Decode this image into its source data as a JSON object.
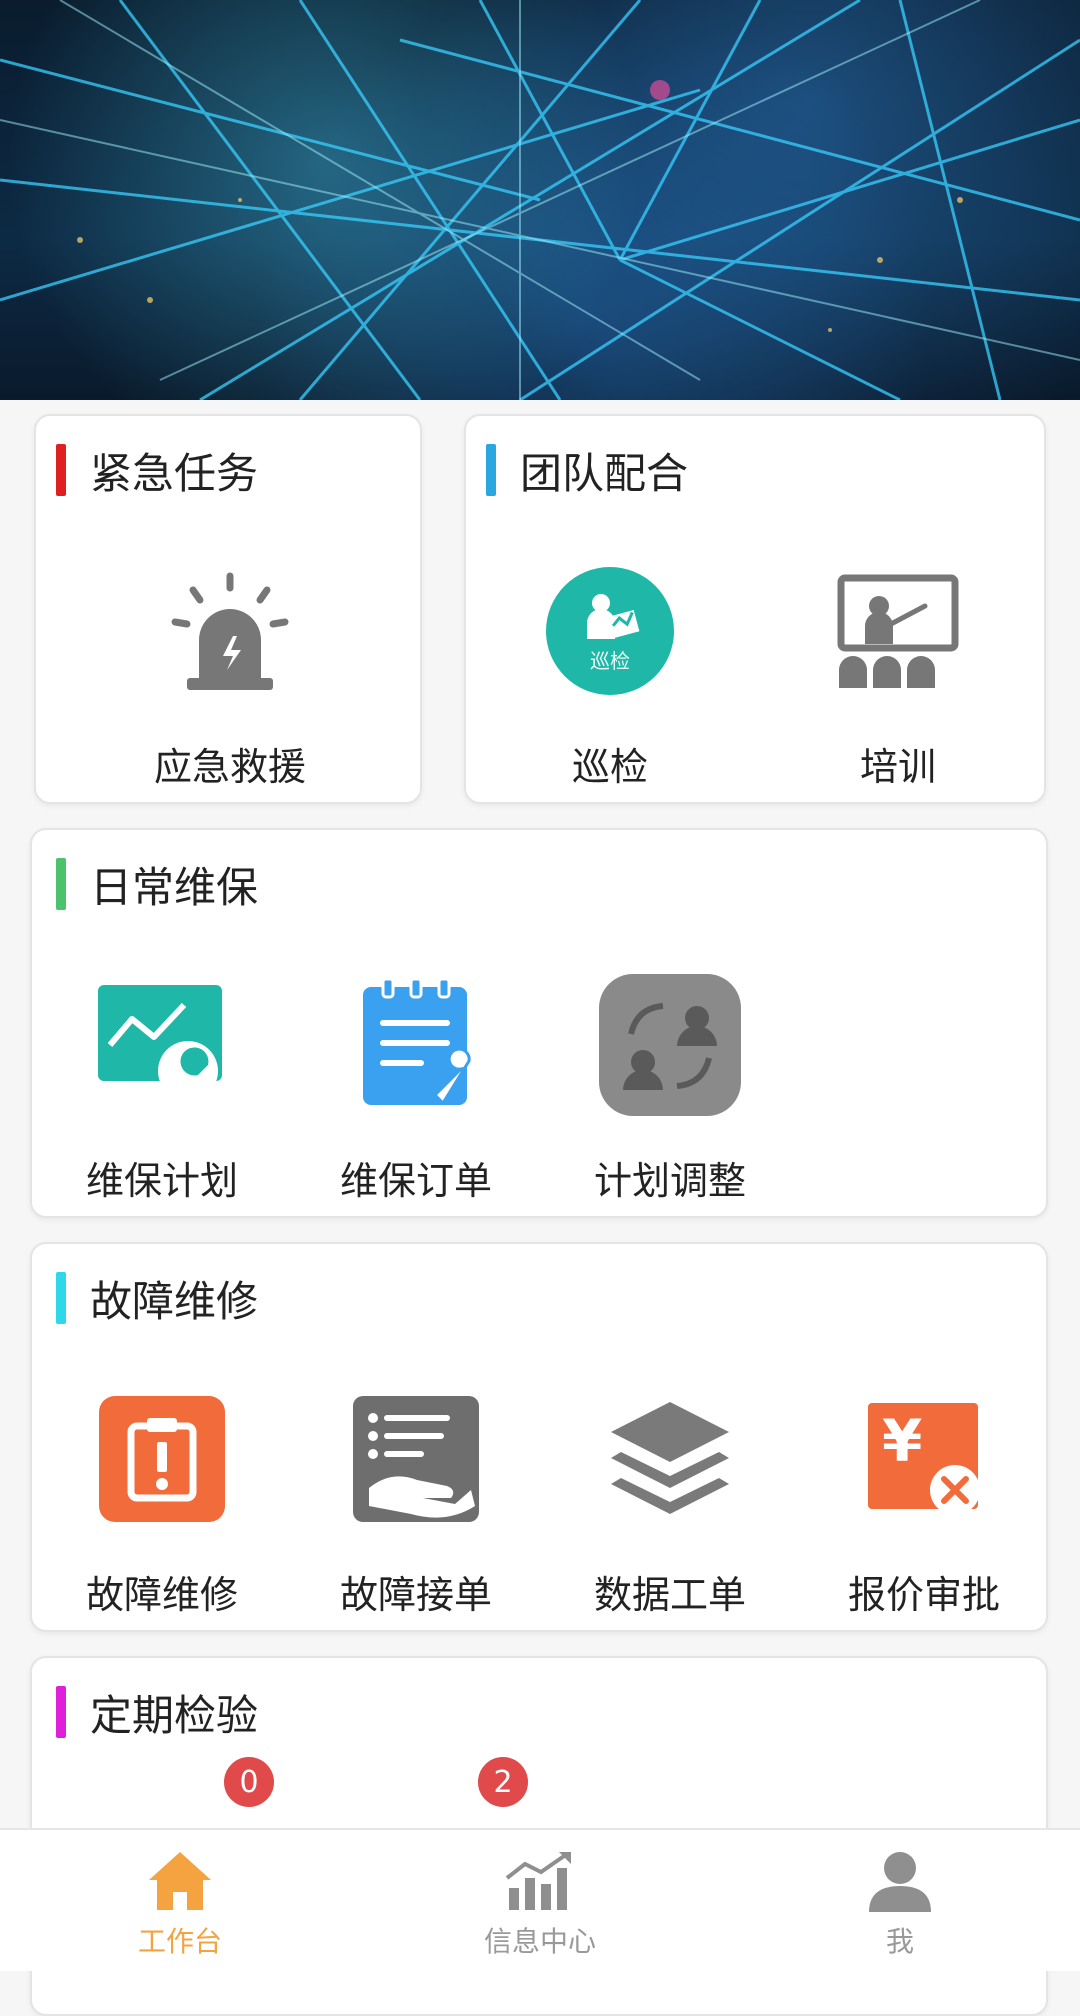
{
  "sections": {
    "emergency": {
      "title": "紧急任务",
      "accent": "#e02020",
      "items": [
        {
          "label": "应急救援",
          "icon": "alarm-light-icon"
        }
      ]
    },
    "team": {
      "title": "团队配合",
      "accent": "#2aa6e0",
      "items": [
        {
          "label": "巡检",
          "icon": "inspection-icon",
          "icon_text": "巡检"
        },
        {
          "label": "培训",
          "icon": "training-icon"
        }
      ]
    },
    "maintenance": {
      "title": "日常维保",
      "accent": "#4cc26a",
      "items": [
        {
          "label": "维保计划",
          "icon": "maintenance-plan-icon"
        },
        {
          "label": "维保订单",
          "icon": "maintenance-order-icon"
        },
        {
          "label": "计划调整",
          "icon": "plan-adjust-icon"
        }
      ]
    },
    "repair": {
      "title": "故障维修",
      "accent": "#2fd8e8",
      "items": [
        {
          "label": "故障维修",
          "icon": "fault-repair-icon"
        },
        {
          "label": "故障接单",
          "icon": "fault-accept-icon"
        },
        {
          "label": "数据工单",
          "icon": "data-order-icon"
        },
        {
          "label": "报价审批",
          "icon": "quote-approval-icon",
          "icon_text": "¥"
        }
      ]
    },
    "inspection": {
      "title": "定期检验",
      "accent": "#e020d8",
      "items": [
        {
          "icon": "inspection-item-1-icon",
          "badge": "0"
        },
        {
          "icon": "inspection-item-2-icon",
          "badge": "2"
        },
        {
          "icon": "inspection-item-3-icon"
        },
        {
          "icon": "inspection-item-4-icon"
        }
      ]
    }
  },
  "tabbar": {
    "active_color": "#f5a341",
    "inactive_color": "#999999",
    "tabs": [
      {
        "label": "工作台",
        "icon": "home-icon",
        "active": true
      },
      {
        "label": "信息中心",
        "icon": "stats-chart-icon",
        "active": false
      },
      {
        "label": "我",
        "icon": "user-icon",
        "active": false
      }
    ]
  }
}
